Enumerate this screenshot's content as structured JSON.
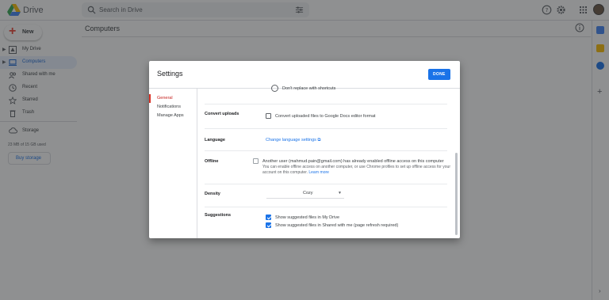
{
  "app": {
    "title": "Drive"
  },
  "search": {
    "placeholder": "Search in Drive"
  },
  "new_button": {
    "label": "New"
  },
  "sidebar": {
    "items": [
      {
        "label": "My Drive"
      },
      {
        "label": "Computers"
      },
      {
        "label": "Shared with me"
      },
      {
        "label": "Recent"
      },
      {
        "label": "Starred"
      },
      {
        "label": "Trash"
      }
    ],
    "storage_label": "Storage",
    "storage_used": "23 MB of 15 GB used",
    "buy_storage": "Buy storage"
  },
  "main": {
    "title": "Computers"
  },
  "settings": {
    "title": "Settings",
    "done_label": "DONE",
    "tabs": [
      {
        "label": "General"
      },
      {
        "label": "Notifications"
      },
      {
        "label": "Manage Apps"
      }
    ],
    "shortcut_option": "Don't replace with shortcuts",
    "convert_uploads": {
      "label": "Convert uploads",
      "option": "Convert uploaded files to Google Docs editor format"
    },
    "language": {
      "label": "Language",
      "link": "Change language settings ⧉"
    },
    "offline": {
      "label": "Offline",
      "text": "Another user (mahmud.pain@gmail.com) has already enabled offline access on this computer",
      "sub_text": "You can enable offline access on another computer, or use Chrome profiles to set up offline access for your account on this computer.",
      "learn_more": "Learn more"
    },
    "density": {
      "label": "Density",
      "value": "Cozy"
    },
    "suggestions": {
      "label": "Suggestions",
      "options": [
        "Show suggested files in My Drive",
        "Show suggested files in Shared with me (page refresh required)"
      ]
    }
  }
}
